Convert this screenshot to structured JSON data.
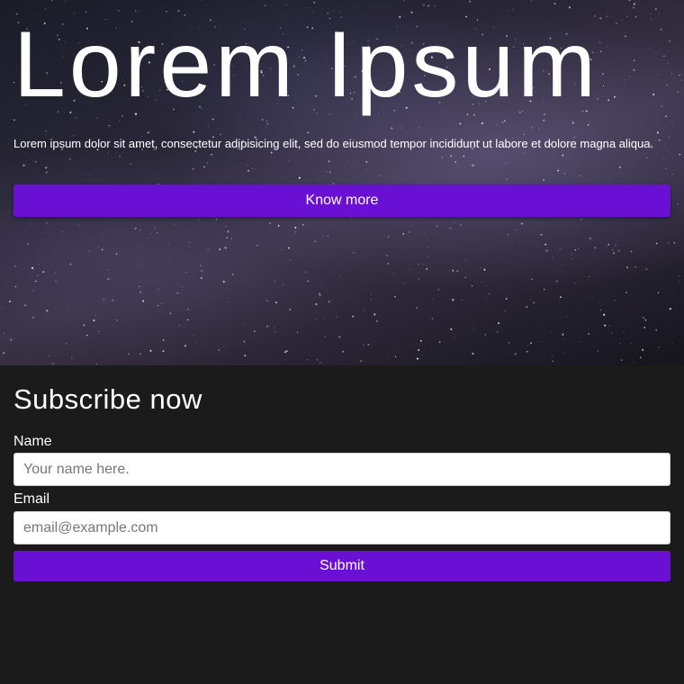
{
  "hero": {
    "title": "Lorem Ipsum",
    "text": "Lorem ipsum dolor sit amet, consectetur adipisicing elit, sed do eiusmod tempor incididunt ut labore et dolore magna aliqua.",
    "button_label": "Know more"
  },
  "subscribe": {
    "title": "Subscribe now",
    "name_label": "Name",
    "name_placeholder": "Your name here.",
    "email_label": "Email",
    "email_placeholder": "email@example.com",
    "submit_label": "Submit"
  },
  "colors": {
    "accent": "#6a0fd4",
    "page_background": "#1b1b1b",
    "text": "#ffffff"
  }
}
